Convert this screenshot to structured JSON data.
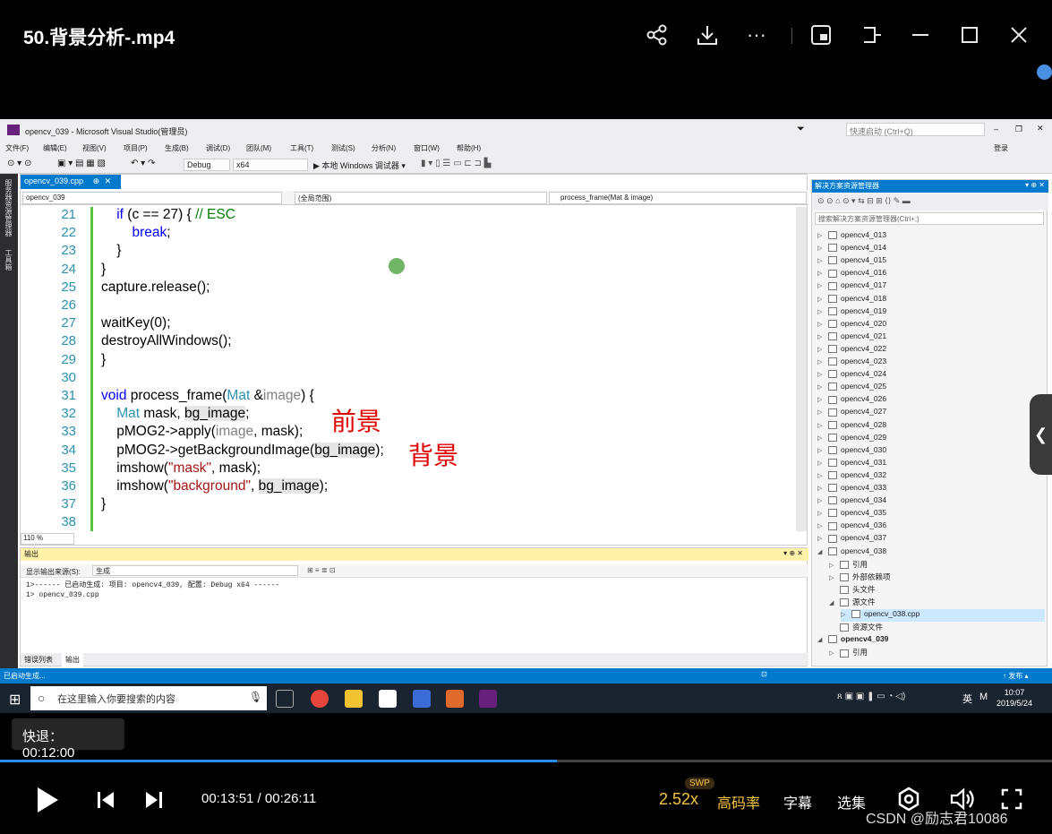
{
  "player": {
    "title": "50.背景分析-.mp4",
    "hint": "快退：00:12:00",
    "time": "00:13:51 / 00:26:11",
    "progress": 0.529,
    "speed": "2.52x",
    "swp": "SWP",
    "quality": "高码率",
    "subtitle": "字幕",
    "episodes": "选集",
    "watermark": "CSDN @励志君10086"
  },
  "vs": {
    "window_title": "opencv_039 - Microsoft Visual Studio(管理员)",
    "quick_launch": "快速启动 (Ctrl+Q)",
    "login": "登录",
    "menus": [
      "文件(F)",
      "编辑(E)",
      "视图(V)",
      "项目(P)",
      "生成(B)",
      "调试(D)",
      "团队(M)",
      "工具(T)",
      "测试(S)",
      "分析(N)",
      "窗口(W)",
      "帮助(H)"
    ],
    "toolbar": {
      "config": "Debug",
      "platform": "x64",
      "run": "▶ 本地 Windows 调试器 ▾"
    },
    "left_strip": [
      "服务器资源管理器",
      "工具箱"
    ],
    "doc_tab": "opencv_039.cpp",
    "nav": {
      "project": "opencv_039",
      "scope": "(全局范围)",
      "func": "process_frame(Mat & image)"
    },
    "zoom": "110 %",
    "code_lines": [
      {
        "n": "21",
        "segs": [
          [
            "",
            "    "
          ],
          [
            "kw",
            "if"
          ],
          [
            "",
            " (c == 27) { "
          ],
          [
            "cm",
            "// ESC"
          ]
        ]
      },
      {
        "n": "22",
        "segs": [
          [
            "",
            "        "
          ],
          [
            "kw",
            "break"
          ],
          [
            "",
            ";"
          ]
        ]
      },
      {
        "n": "23",
        "segs": [
          [
            "",
            "    }"
          ]
        ]
      },
      {
        "n": "24",
        "segs": [
          [
            "",
            "}"
          ]
        ]
      },
      {
        "n": "25",
        "segs": [
          [
            "",
            "capture.release();"
          ]
        ]
      },
      {
        "n": "26",
        "segs": [
          [
            "",
            ""
          ]
        ]
      },
      {
        "n": "27",
        "segs": [
          [
            "",
            "waitKey(0);"
          ]
        ]
      },
      {
        "n": "28",
        "segs": [
          [
            "",
            "destroyAllWindows();"
          ]
        ]
      },
      {
        "n": "29",
        "segs": [
          [
            "",
            "}"
          ]
        ]
      },
      {
        "n": "30",
        "segs": [
          [
            "",
            ""
          ]
        ]
      },
      {
        "n": "31",
        "segs": [
          [
            "kw",
            "void"
          ],
          [
            "",
            " process_frame("
          ],
          [
            "tp",
            "Mat"
          ],
          [
            "",
            " &"
          ],
          [
            "par",
            "image"
          ],
          [
            "",
            ") {"
          ]
        ]
      },
      {
        "n": "32",
        "segs": [
          [
            "",
            "    "
          ],
          [
            "tp",
            "Mat"
          ],
          [
            "",
            " mask, "
          ],
          [
            "hl",
            "bg_image"
          ],
          [
            "",
            ";"
          ]
        ]
      },
      {
        "n": "33",
        "segs": [
          [
            "",
            "    pMOG2->apply("
          ],
          [
            "par",
            "image"
          ],
          [
            "",
            ", mask);"
          ]
        ]
      },
      {
        "n": "34",
        "segs": [
          [
            "",
            "    pMOG2->getBackgroundImage("
          ],
          [
            "hl",
            "bg_image"
          ],
          [
            "",
            ");"
          ]
        ]
      },
      {
        "n": "35",
        "segs": [
          [
            "",
            "    imshow("
          ],
          [
            "str",
            "\"mask\""
          ],
          [
            "",
            ", mask);"
          ]
        ]
      },
      {
        "n": "36",
        "segs": [
          [
            "",
            "    imshow("
          ],
          [
            "str",
            "\"background\""
          ],
          [
            "",
            ", "
          ],
          [
            "hl",
            "bg_image"
          ],
          [
            "",
            ");"
          ]
        ]
      },
      {
        "n": "37",
        "segs": [
          [
            "",
            "}"
          ]
        ]
      },
      {
        "n": "38",
        "segs": [
          [
            "",
            ""
          ]
        ]
      }
    ],
    "annot_fg": "前景",
    "annot_bg": "背景",
    "output": {
      "header": "输出",
      "source_label": "显示输出来源(S):",
      "source_value": "生成",
      "lines": [
        "1>------ 已启动生成: 项目: opencv4_039, 配置: Debug x64 ------",
        "1>  opencv_039.cpp"
      ],
      "tabs": [
        "错误列表",
        "输出"
      ]
    },
    "solution": {
      "header": "解决方案资源管理器",
      "search": "搜索解决方案资源管理器(Ctrl+;)",
      "items": [
        {
          "label": "opencv4_013",
          "lvl": 0,
          "arrow": "▷"
        },
        {
          "label": "opencv4_014",
          "lvl": 0,
          "arrow": "▷"
        },
        {
          "label": "opencv4_015",
          "lvl": 0,
          "arrow": "▷"
        },
        {
          "label": "opencv4_016",
          "lvl": 0,
          "arrow": "▷"
        },
        {
          "label": "opencv4_017",
          "lvl": 0,
          "arrow": "▷"
        },
        {
          "label": "opencv4_018",
          "lvl": 0,
          "arrow": "▷"
        },
        {
          "label": "opencv4_019",
          "lvl": 0,
          "arrow": "▷"
        },
        {
          "label": "opencv4_020",
          "lvl": 0,
          "arrow": "▷"
        },
        {
          "label": "opencv4_021",
          "lvl": 0,
          "arrow": "▷"
        },
        {
          "label": "opencv4_022",
          "lvl": 0,
          "arrow": "▷"
        },
        {
          "label": "opencv4_023",
          "lvl": 0,
          "arrow": "▷"
        },
        {
          "label": "opencv4_024",
          "lvl": 0,
          "arrow": "▷"
        },
        {
          "label": "opencv4_025",
          "lvl": 0,
          "arrow": "▷"
        },
        {
          "label": "opencv4_026",
          "lvl": 0,
          "arrow": "▷"
        },
        {
          "label": "opencv4_027",
          "lvl": 0,
          "arrow": "▷"
        },
        {
          "label": "opencv4_028",
          "lvl": 0,
          "arrow": "▷"
        },
        {
          "label": "opencv4_029",
          "lvl": 0,
          "arrow": "▷"
        },
        {
          "label": "opencv4_030",
          "lvl": 0,
          "arrow": "▷"
        },
        {
          "label": "opencv4_031",
          "lvl": 0,
          "arrow": "▷"
        },
        {
          "label": "opencv4_032",
          "lvl": 0,
          "arrow": "▷"
        },
        {
          "label": "opencv4_033",
          "lvl": 0,
          "arrow": "▷"
        },
        {
          "label": "opencv4_034",
          "lvl": 0,
          "arrow": "▷"
        },
        {
          "label": "opencv4_035",
          "lvl": 0,
          "arrow": "▷"
        },
        {
          "label": "opencv4_036",
          "lvl": 0,
          "arrow": "▷"
        },
        {
          "label": "opencv4_037",
          "lvl": 0,
          "arrow": "▷"
        },
        {
          "label": "opencv4_038",
          "lvl": 0,
          "arrow": "◢"
        },
        {
          "label": "引用",
          "lvl": 1,
          "arrow": "▷"
        },
        {
          "label": "外部依赖项",
          "lvl": 1,
          "arrow": "▷"
        },
        {
          "label": "头文件",
          "lvl": 1,
          "arrow": ""
        },
        {
          "label": "源文件",
          "lvl": 1,
          "arrow": "◢"
        },
        {
          "label": "opencv_038.cpp",
          "lvl": 2,
          "arrow": "▷",
          "sel": true
        },
        {
          "label": "资源文件",
          "lvl": 1,
          "arrow": ""
        },
        {
          "label": "opencv4_039",
          "lvl": 0,
          "arrow": "◢",
          "bold": true
        },
        {
          "label": "引用",
          "lvl": 1,
          "arrow": "▷"
        }
      ]
    },
    "status_left": "已启动生成...",
    "status_right": "↑ 发布 ▴",
    "taskbar_search": "在这里输入你要搜索的内容",
    "tray_lang": "英",
    "clock_time": "10:07",
    "clock_date": "2019/5/24"
  },
  "icons": [
    "share-icon",
    "download-icon",
    "more-icon",
    "pip-icon",
    "pin-icon",
    "minimize-icon",
    "maximize-icon",
    "close-icon"
  ]
}
